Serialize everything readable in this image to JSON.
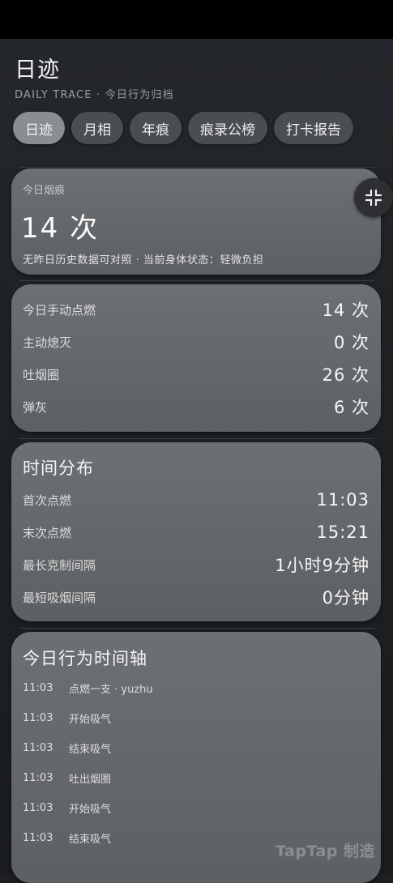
{
  "app": {
    "title": "日迹",
    "subtitle": "DAILY TRACE · 今日行为归档"
  },
  "tabs": [
    {
      "label": "日迹",
      "active": true
    },
    {
      "label": "月相",
      "active": false
    },
    {
      "label": "年痕",
      "active": false
    },
    {
      "label": "痕录公榜",
      "active": false
    },
    {
      "label": "打卡报告",
      "active": false
    }
  ],
  "today_card": {
    "label": "今日烟痕",
    "value": "14 次",
    "note": "无昨日历史数据可对照 · 当前身体状态：轻微负担",
    "collapse_icon": "collapse-arrows-icon"
  },
  "stats": [
    {
      "label": "今日手动点燃",
      "value": "14 次"
    },
    {
      "label": "主动熄灭",
      "value": "0 次"
    },
    {
      "label": "吐烟圈",
      "value": "26 次"
    },
    {
      "label": "弹灰",
      "value": "6 次"
    }
  ],
  "time_distribution": {
    "heading": "时间分布",
    "rows": [
      {
        "label": "首次点燃",
        "value": "11:03"
      },
      {
        "label": "末次点燃",
        "value": "15:21"
      },
      {
        "label": "最长克制间隔",
        "value": "1小时9分钟"
      },
      {
        "label": "最短吸烟间隔",
        "value": "0分钟"
      }
    ]
  },
  "timeline": {
    "heading": "今日行为时间轴",
    "items": [
      {
        "time": "11:03",
        "event": "点燃一支 · yuzhu"
      },
      {
        "time": "11:03",
        "event": "开始吸气"
      },
      {
        "time": "11:03",
        "event": "结束吸气"
      },
      {
        "time": "11:03",
        "event": "吐出烟圈"
      },
      {
        "time": "11:03",
        "event": "开始吸气"
      },
      {
        "time": "11:03",
        "event": "结束吸气"
      }
    ]
  },
  "watermark": "TapTap 制造"
}
